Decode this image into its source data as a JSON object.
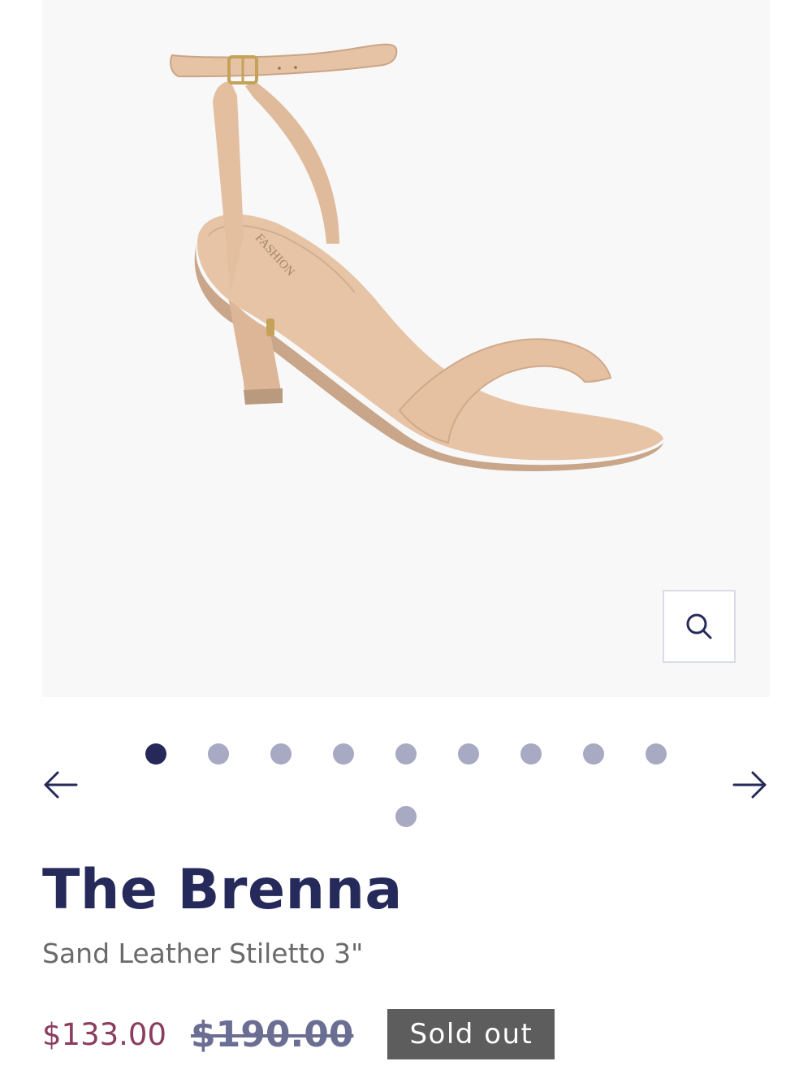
{
  "product": {
    "title": "The Brenna",
    "subtitle": "Sand Leather Stiletto 3\"",
    "price_sale": "$133.00",
    "price_compare": "$190.00",
    "badge": "Sold out",
    "image_insole_brand": "FASHION"
  },
  "gallery": {
    "image_count": 10,
    "active_index": 0,
    "zoom_icon": "search-icon",
    "prev_icon": "arrow-left-icon",
    "next_icon": "arrow-right-icon"
  },
  "colors": {
    "brand_navy": "#252a5a",
    "sale_price": "#8a3d5f",
    "compare_price": "#6b6e93",
    "badge_bg": "#5d5d5d",
    "dot_inactive": "#a8a9c2",
    "shoe_tan": "#e7c4a6"
  }
}
